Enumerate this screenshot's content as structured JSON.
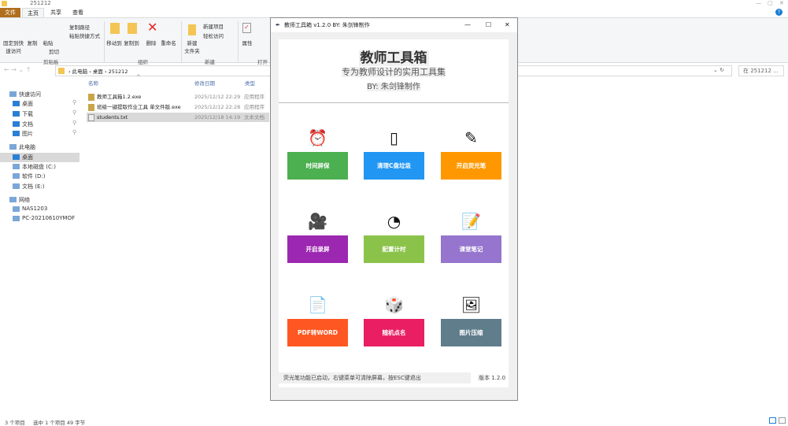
{
  "explorer": {
    "title": "251212",
    "tabs": [
      "文件",
      "主页",
      "共享",
      "查看"
    ],
    "ribbon": {
      "clipboard": {
        "pin": "固定到快速访问",
        "copy": "复制",
        "paste": "粘贴",
        "copy_path": "复制路径",
        "paste_shortcut": "粘贴快捷方式",
        "cut": "剪切",
        "label": "剪贴板"
      },
      "organize": {
        "move": "移动到",
        "copyto": "复制到",
        "delete": "删除",
        "rename": "重命名",
        "label": "组织"
      },
      "new": {
        "folder": "新建\n文件夹",
        "item": "新建项目",
        "easy": "轻松访问",
        "label": "新建"
      },
      "open": {
        "props": "属性",
        "label": "打开"
      }
    },
    "breadcrumb": [
      "此电脑",
      "桌面",
      "251212"
    ],
    "search_placeholder": "在 251212 ...",
    "columns": [
      "名称",
      "修改日期",
      "类型"
    ],
    "files": [
      {
        "name": "教师工具箱1.2.exe",
        "date": "2025/12/12 22:29",
        "type": "应用程序"
      },
      {
        "name": "班级一键提取作业工具 单文件版.exe",
        "date": "2025/12/12 22:28",
        "type": "应用程序"
      },
      {
        "name": "students.txt",
        "date": "2025/12/18 14:19",
        "type": "文本文档"
      }
    ],
    "sidebar": [
      "快速访问",
      "桌面",
      "下载",
      "文档",
      "图片",
      "此电脑",
      "桌面",
      "本地磁盘 (C:)",
      "软件 (D:)",
      "文档 (E:)",
      "网络",
      "NAS1203",
      "PC-20210610YMOF"
    ],
    "status": {
      "count": "3 个项目",
      "selected": "选中 1 个项目  49 字节"
    }
  },
  "tool": {
    "window_title": "教师工具箱 v1.2.0   BY: 朱剑锋制作",
    "title": "教师工具箱",
    "subtitle": "专为教师设计的实用工具集",
    "author": "BY: 朱剑锋制作",
    "buttons": [
      {
        "label": "时间屏保",
        "color": "#4caf50",
        "icon": "alarm-clock"
      },
      {
        "label": "清理C盘垃圾",
        "color": "#2196f3",
        "icon": "blank-page"
      },
      {
        "label": "开启荧光笔",
        "color": "#ff9800",
        "icon": "pencil"
      },
      {
        "label": "开启录屏",
        "color": "#9c27b0",
        "icon": "movie-camera"
      },
      {
        "label": "配置计时",
        "color": "#8bc34a",
        "icon": "stopwatch"
      },
      {
        "label": "课堂笔记",
        "color": "#9575cd",
        "icon": "memo"
      },
      {
        "label": "PDF转WORD",
        "color": "#ff5722",
        "icon": "document"
      },
      {
        "label": "随机点名",
        "color": "#e91e63",
        "icon": "dice"
      },
      {
        "label": "图片压缩",
        "color": "#607d8b",
        "icon": "picture"
      }
    ],
    "footer": "荧光笔功能已启动，右键菜单可清除屏幕，按ESC键退出",
    "version": "版本 1.2.0"
  }
}
